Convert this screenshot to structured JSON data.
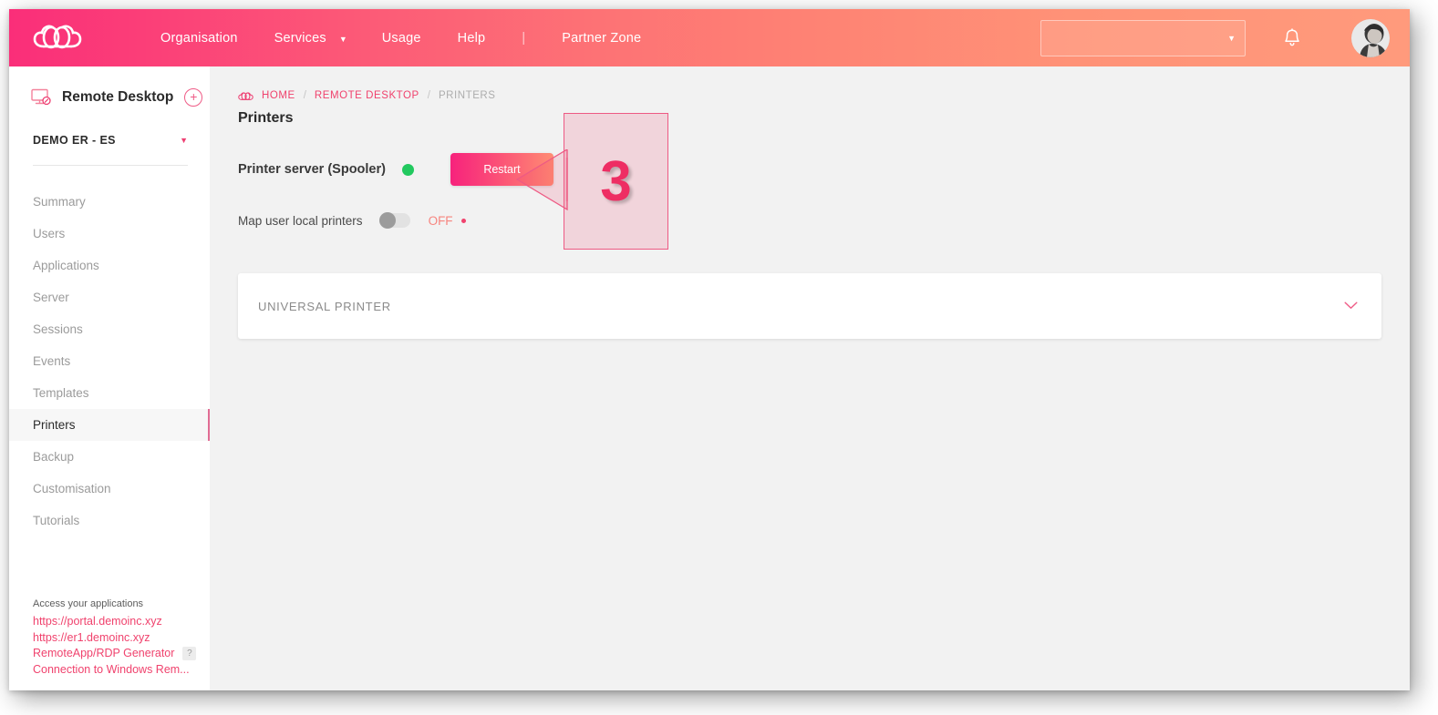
{
  "header": {
    "logo_icon": "cloud-logo-icon",
    "nav": [
      {
        "label": "Organisation",
        "caret": false
      },
      {
        "label": "Services",
        "caret": true
      },
      {
        "label": "Usage",
        "caret": false
      },
      {
        "label": "Help",
        "caret": false
      }
    ],
    "separator": "|",
    "partner_zone_label": "Partner Zone",
    "org_select_value": "",
    "org_select_caret_icon": "chevron-down-icon",
    "notification_icon": "bell-icon",
    "avatar_icon": "user-avatar"
  },
  "sidebar": {
    "service_icon": "remote-desktop-icon",
    "service_name": "Remote Desktop",
    "add_button_label": "+",
    "organisation": "DEMO ER - ES",
    "organisation_caret_icon": "chevron-down-icon",
    "menu": [
      {
        "label": "Summary",
        "active": false
      },
      {
        "label": "Users",
        "active": false
      },
      {
        "label": "Applications",
        "active": false
      },
      {
        "label": "Server",
        "active": false
      },
      {
        "label": "Sessions",
        "active": false
      },
      {
        "label": "Events",
        "active": false
      },
      {
        "label": "Templates",
        "active": false
      },
      {
        "label": "Printers",
        "active": true
      },
      {
        "label": "Backup",
        "active": false
      },
      {
        "label": "Customisation",
        "active": false
      },
      {
        "label": "Tutorials",
        "active": false
      }
    ],
    "footer": {
      "caption": "Access your applications",
      "links": [
        "https://portal.demoinc.xyz",
        "https://er1.demoinc.xyz",
        "RemoteApp/RDP Generator",
        "Connection to Windows Rem..."
      ],
      "help_badge": "?"
    }
  },
  "main": {
    "breadcrumb": {
      "home_icon": "cloud-icon",
      "items": [
        "HOME",
        "REMOTE DESKTOP",
        "PRINTERS"
      ],
      "separator": "/"
    },
    "page_title": "Printers",
    "spooler": {
      "label": "Printer server (Spooler)",
      "status_color": "#22c95f",
      "restart_label": "Restart"
    },
    "map_printers": {
      "label": "Map user local printers",
      "state": "OFF",
      "toggle_on": false
    },
    "printer_card": {
      "title": "UNIVERSAL PRINTER",
      "chevron_icon": "chevron-down-icon"
    }
  },
  "annotation": {
    "number": "3",
    "color": "#ee2d63"
  }
}
